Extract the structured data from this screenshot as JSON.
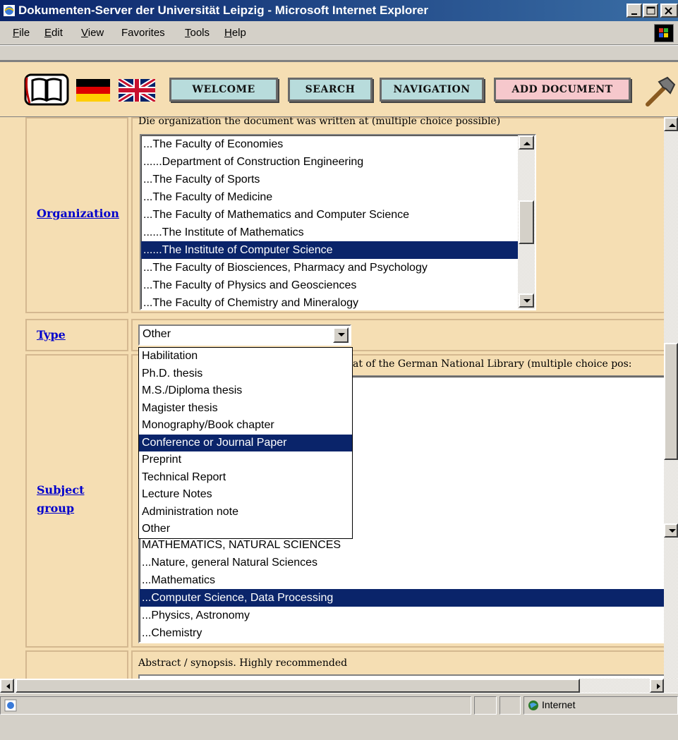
{
  "window": {
    "title": "Dokumenten-Server der Universität Leipzig - Microsoft Internet Explorer"
  },
  "menu": {
    "items": [
      {
        "u": "F",
        "rest": "ile"
      },
      {
        "u": "E",
        "rest": "dit"
      },
      {
        "u": "V",
        "rest": "iew"
      },
      {
        "u": "",
        "rest": "Favorites"
      },
      {
        "u": "T",
        "rest": "ools"
      },
      {
        "u": "H",
        "rest": "elp"
      }
    ]
  },
  "nav": {
    "welcome": "WELCOME",
    "search": "SEARCH",
    "navigation": "NAVIGATION",
    "add_document": "ADD DOCUMENT"
  },
  "form": {
    "organization": {
      "label": "Organization",
      "hint": "Die organization the document was written at (multiple choice possible)",
      "options": [
        "...The Faculty of Economies",
        "......Department of Construction Engineering",
        "...The Faculty of Sports",
        "...The Faculty of Medicine",
        "...The Faculty of Mathematics and Computer Science",
        "......The Institute of Mathematics",
        "......The Institute of Computer Science",
        "...The Faculty of Biosciences, Pharmacy and Psychology",
        "...The Faculty of Physics and Geosciences",
        "...The Faculty of Chemistry and Mineralogy"
      ],
      "selected_index": 6
    },
    "type": {
      "label": "Type",
      "value": "Other",
      "options": [
        "Habilitation",
        "Ph.D. thesis",
        "M.S./Diploma thesis",
        "Magister thesis",
        "Monography/Book chapter",
        "Conference or Journal Paper",
        "Preprint",
        "Technical Report",
        "Lecture Notes",
        "Administration note",
        "Other"
      ],
      "highlighted_index": 5
    },
    "subject_group": {
      "label_line1": "Subject",
      "label_line2": "group",
      "hint_visible": "at of the German National Library (multiple choice pos:",
      "options_visible": [
        "MATHEMATICS, NATURAL SCIENCES",
        "...Nature, general Natural Sciences",
        "...Mathematics",
        "...Computer Science, Data Processing",
        "...Physics, Astronomy",
        "...Chemistry"
      ],
      "selected_index": 3
    },
    "abstract": {
      "hint": "Abstract / synopsis. Highly recommended"
    }
  },
  "status": {
    "zone": "Internet"
  }
}
